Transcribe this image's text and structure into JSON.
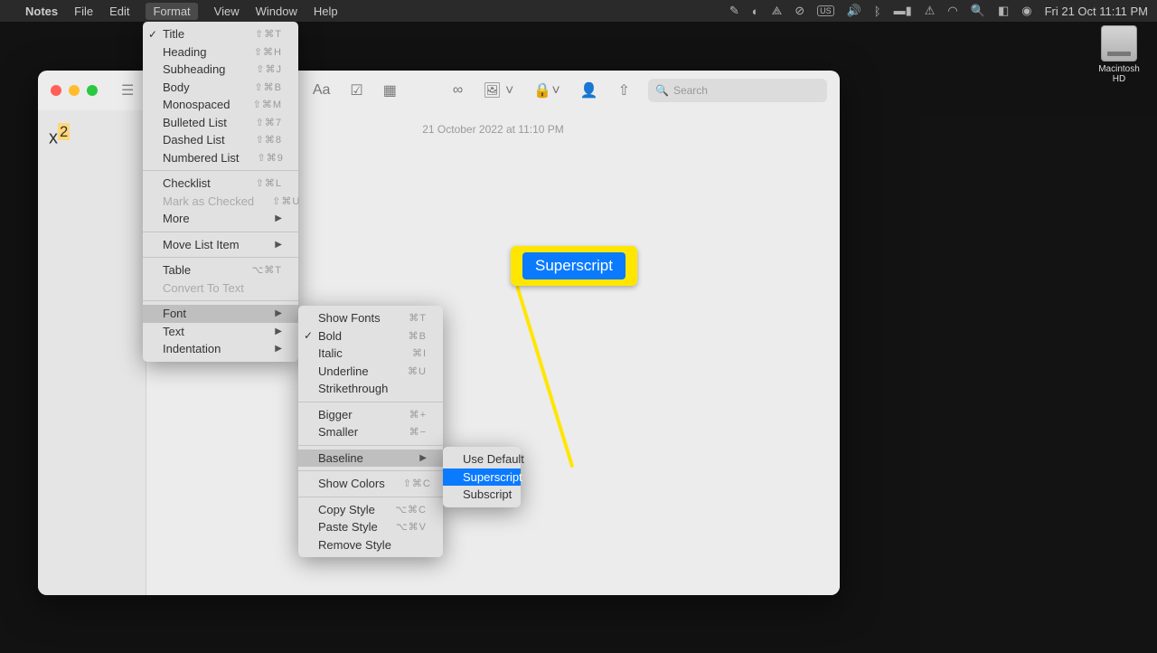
{
  "menubar": {
    "app": "Notes",
    "items": [
      "File",
      "Edit",
      "Format",
      "View",
      "Window",
      "Help"
    ],
    "time": "Fri 21 Oct  11:11 PM"
  },
  "desktop": {
    "hd_label": "Macintosh HD"
  },
  "window": {
    "search_placeholder": "Search",
    "timestamp": "21 October 2022 at 11:10 PM",
    "preview_base": "x",
    "preview_sup": "2"
  },
  "format_menu": [
    {
      "label": "Title",
      "shortcut": "⇧⌘T",
      "checked": true
    },
    {
      "label": "Heading",
      "shortcut": "⇧⌘H"
    },
    {
      "label": "Subheading",
      "shortcut": "⇧⌘J"
    },
    {
      "label": "Body",
      "shortcut": "⇧⌘B"
    },
    {
      "label": "Monospaced",
      "shortcut": "⇧⌘M"
    },
    {
      "label": "Bulleted List",
      "shortcut": "⇧⌘7"
    },
    {
      "label": "Dashed List",
      "shortcut": "⇧⌘8"
    },
    {
      "label": "Numbered List",
      "shortcut": "⇧⌘9"
    },
    {
      "sep": true
    },
    {
      "label": "Checklist",
      "shortcut": "⇧⌘L"
    },
    {
      "label": "Mark as Checked",
      "shortcut": "⇧⌘U",
      "disabled": true
    },
    {
      "label": "More",
      "arrow": true
    },
    {
      "sep": true
    },
    {
      "label": "Move List Item",
      "arrow": true
    },
    {
      "sep": true
    },
    {
      "label": "Table",
      "shortcut": "⌥⌘T"
    },
    {
      "label": "Convert To Text",
      "disabled": true
    },
    {
      "sep": true
    },
    {
      "label": "Font",
      "arrow": true,
      "highlighted": true
    },
    {
      "label": "Text",
      "arrow": true
    },
    {
      "label": "Indentation",
      "arrow": true
    }
  ],
  "font_menu": [
    {
      "label": "Show Fonts",
      "shortcut": "⌘T"
    },
    {
      "label": "Bold",
      "shortcut": "⌘B",
      "checked": true
    },
    {
      "label": "Italic",
      "shortcut": "⌘I"
    },
    {
      "label": "Underline",
      "shortcut": "⌘U"
    },
    {
      "label": "Strikethrough"
    },
    {
      "sep": true
    },
    {
      "label": "Bigger",
      "shortcut": "⌘+"
    },
    {
      "label": "Smaller",
      "shortcut": "⌘−"
    },
    {
      "sep": true
    },
    {
      "label": "Baseline",
      "arrow": true,
      "highlighted": true
    },
    {
      "sep": true
    },
    {
      "label": "Show Colors",
      "shortcut": "⇧⌘C"
    },
    {
      "sep": true
    },
    {
      "label": "Copy Style",
      "shortcut": "⌥⌘C"
    },
    {
      "label": "Paste Style",
      "shortcut": "⌥⌘V"
    },
    {
      "label": "Remove Style"
    }
  ],
  "baseline_menu": [
    {
      "label": "Use Default"
    },
    {
      "label": "Superscript",
      "selected": true
    },
    {
      "label": "Subscript"
    }
  ],
  "callout": {
    "label": "Superscript"
  }
}
